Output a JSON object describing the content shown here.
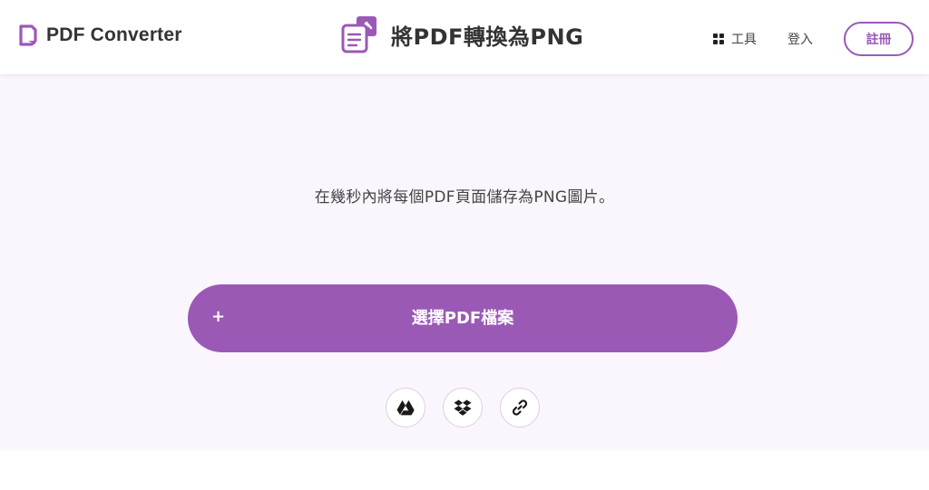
{
  "header": {
    "brand": "PDF Converter",
    "page_title": "將PDF轉換為PNG",
    "nav_tools": "工具",
    "nav_login": "登入",
    "signup": "註冊"
  },
  "hero": {
    "subtitle": "在幾秒內將每個PDF頁面儲存為PNG圖片。",
    "choose_button": "選擇PDF檔案",
    "choose_plus": "+"
  },
  "sources": {
    "icons": [
      "google-drive-icon",
      "dropbox-icon",
      "link-icon"
    ]
  },
  "colors": {
    "accent": "#9b59b6",
    "hero_bg": "#fbf6fd",
    "text": "#333333"
  }
}
